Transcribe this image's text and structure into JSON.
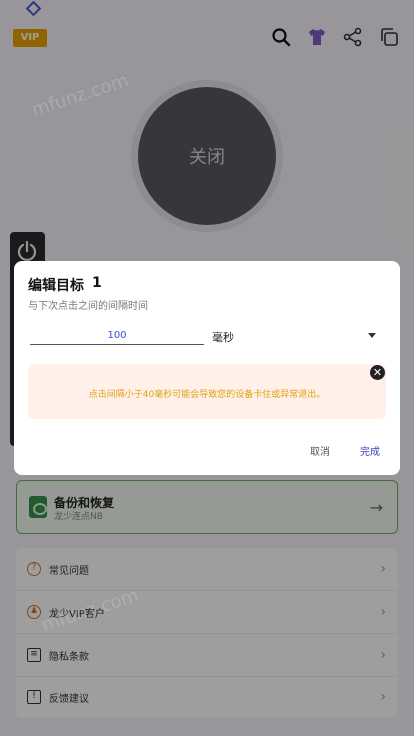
{
  "header": {
    "vip_badge": "VIP",
    "icons": [
      "search-icon",
      "shirt-icon",
      "share-icon",
      "copy-icon"
    ]
  },
  "main": {
    "toggle_label": "关闭"
  },
  "backup": {
    "title": "备份和恢复",
    "subtitle": "龙少连点NB"
  },
  "menu": {
    "items": [
      {
        "label": "常见问题",
        "icon": "question-icon"
      },
      {
        "label": "龙少VIP客户",
        "icon": "vip-user-icon"
      },
      {
        "label": "隐私条款",
        "icon": "document-icon"
      },
      {
        "label": "反馈建议",
        "icon": "feedback-icon"
      }
    ]
  },
  "dialog": {
    "title": "编辑目标",
    "target_number": "1",
    "subtitle": "与下次点击之间的间隔时间",
    "interval_value": "100",
    "unit": "毫秒",
    "warning": "点击间隔小于40毫秒可能会导致您的设备卡住或异常退出。",
    "cancel_label": "取消",
    "done_label": "完成"
  },
  "colors": {
    "vip_gold": "#e8a200",
    "accent_blue": "#3a3fb8",
    "warning_text": "#e0a010",
    "warning_bg": "#fff1ea",
    "backup_border": "#6fae5c"
  }
}
